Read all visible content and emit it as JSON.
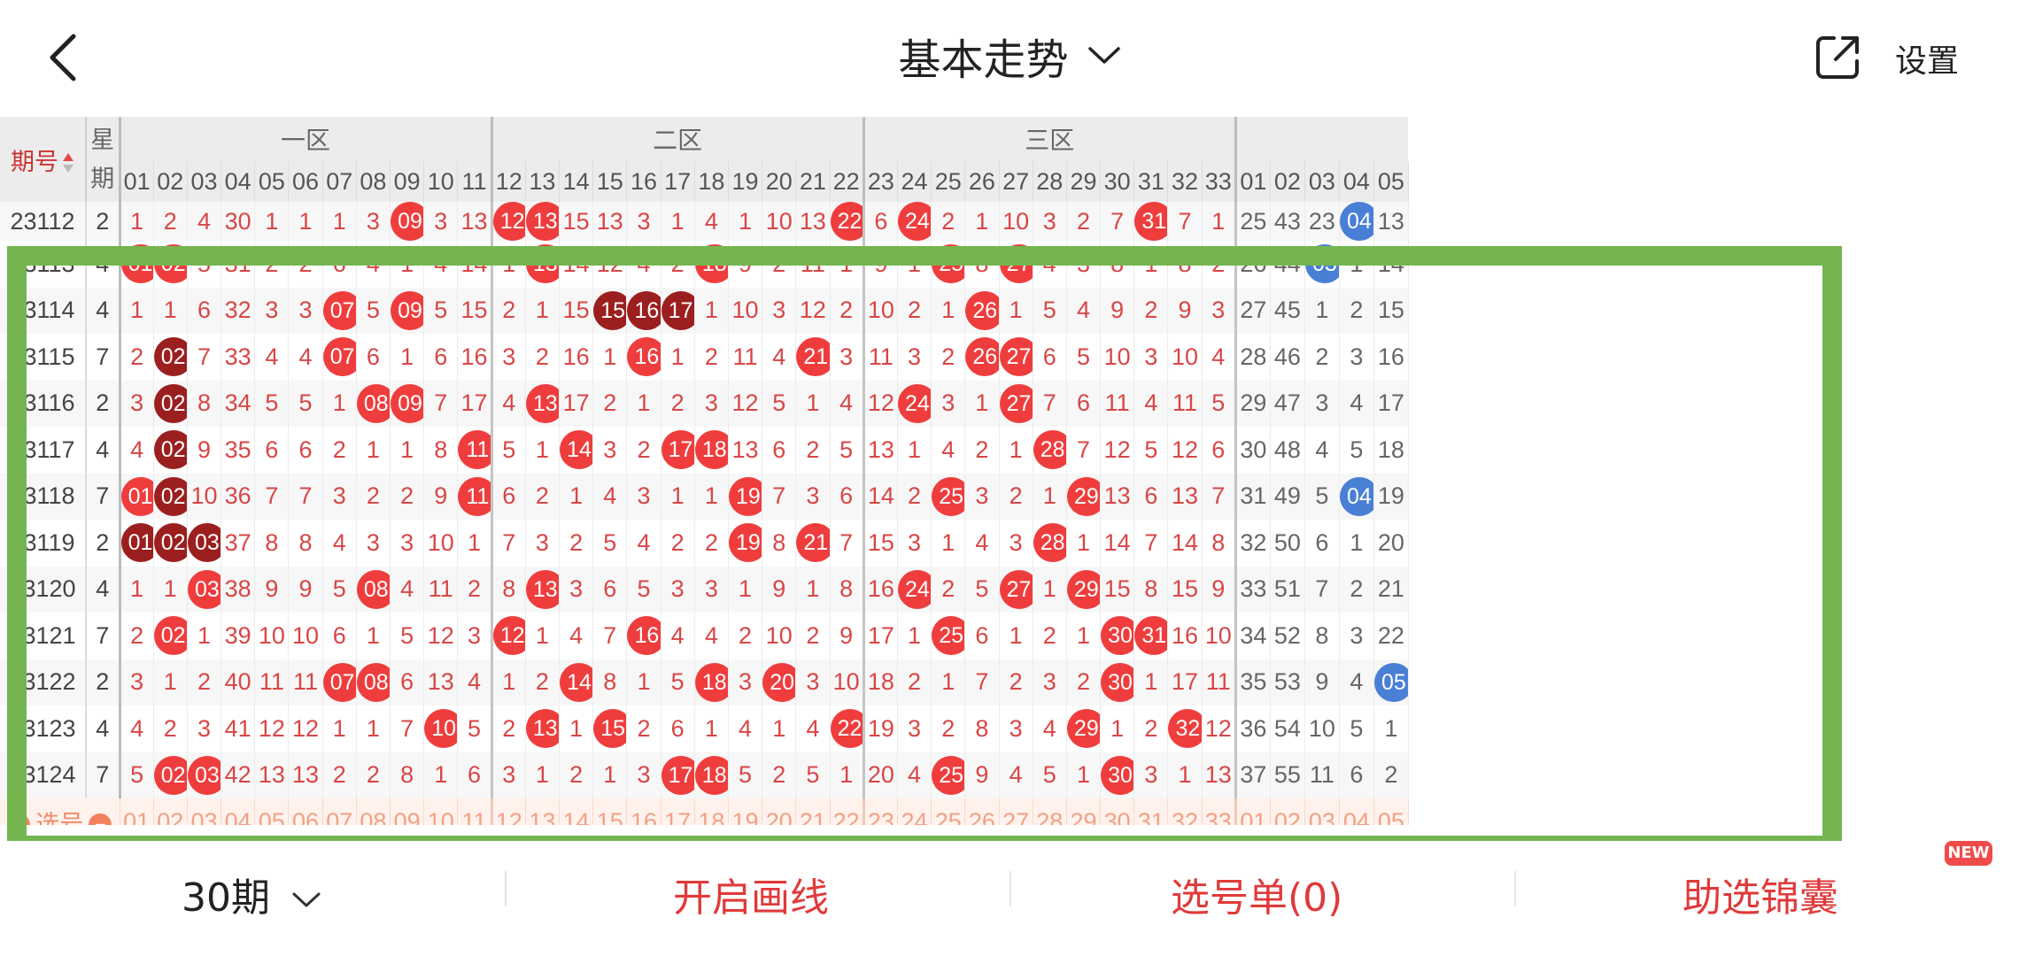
{
  "header": {
    "title": "基本走势",
    "settings_label": "设置"
  },
  "table": {
    "issue_header": "期号",
    "week_header": "星期",
    "zones": [
      "一区",
      "二区",
      "三区"
    ],
    "num_headers_left": [
      "01",
      "02",
      "03",
      "04",
      "05",
      "06",
      "07",
      "08",
      "09",
      "10",
      "11",
      "12",
      "13",
      "14",
      "15",
      "16",
      "17",
      "18",
      "19",
      "20",
      "21",
      "22",
      "23",
      "24",
      "25",
      "26",
      "27",
      "28",
      "29",
      "30",
      "31",
      "32",
      "33"
    ],
    "num_headers_right": [
      "01",
      "02",
      "03",
      "04",
      "05"
    ],
    "rows": [
      {
        "issue": "23112",
        "week": "2",
        "partial": true,
        "cells": [
          "1",
          "2",
          "4",
          "30",
          "1",
          "1",
          "1",
          "3",
          "09",
          "3",
          "13",
          "12",
          "13",
          "15",
          "13",
          "3",
          "1",
          "4",
          "1",
          "10",
          "13",
          "22",
          "6",
          "24",
          "2",
          "1",
          "10",
          "3",
          "2",
          "7",
          "31",
          "7",
          "1"
        ],
        "balls": {
          "9": "red",
          "12": "red",
          "13": "red",
          "22": "red",
          "24": "red",
          "31": "red"
        },
        "right": [
          "25",
          "43",
          "23",
          "04",
          "13"
        ],
        "rballs": {
          "4": "blue"
        }
      },
      {
        "issue": "23113",
        "week": "4",
        "cells": [
          "01",
          "02",
          "5",
          "31",
          "2",
          "2",
          "6",
          "4",
          "1",
          "4",
          "14",
          "1",
          "13",
          "14",
          "12",
          "4",
          "2",
          "18",
          "9",
          "2",
          "11",
          "1",
          "9",
          "1",
          "25",
          "8",
          "27",
          "4",
          "3",
          "8",
          "1",
          "8",
          "2"
        ],
        "balls": {
          "1": "red",
          "2": "red",
          "13": "red",
          "18": "red",
          "25": "red",
          "27": "red"
        },
        "right": [
          "26",
          "44",
          "03",
          "1",
          "14"
        ],
        "rballs": {
          "3": "blue"
        }
      },
      {
        "issue": "23114",
        "week": "4",
        "cells": [
          "1",
          "1",
          "6",
          "32",
          "3",
          "3",
          "07",
          "5",
          "09",
          "5",
          "15",
          "2",
          "1",
          "15",
          "15",
          "16",
          "17",
          "1",
          "10",
          "3",
          "12",
          "2",
          "10",
          "2",
          "1",
          "26",
          "1",
          "5",
          "4",
          "9",
          "2",
          "9",
          "3"
        ],
        "balls": {
          "7": "red",
          "9": "red",
          "15": "dark",
          "16": "dark",
          "17": "dark",
          "26": "red"
        },
        "right": [
          "27",
          "45",
          "1",
          "2",
          "15"
        ],
        "rballs": {}
      },
      {
        "issue": "23115",
        "week": "7",
        "cells": [
          "2",
          "02",
          "7",
          "33",
          "4",
          "4",
          "07",
          "6",
          "1",
          "6",
          "16",
          "3",
          "2",
          "16",
          "1",
          "16",
          "1",
          "2",
          "11",
          "4",
          "21",
          "3",
          "11",
          "3",
          "2",
          "26",
          "27",
          "6",
          "5",
          "10",
          "3",
          "10",
          "4"
        ],
        "balls": {
          "2": "dark",
          "7": "red",
          "16": "red",
          "21": "red",
          "26": "red",
          "27": "red"
        },
        "right": [
          "28",
          "46",
          "2",
          "3",
          "16"
        ],
        "rballs": {}
      },
      {
        "issue": "23116",
        "week": "2",
        "cells": [
          "3",
          "02",
          "8",
          "34",
          "5",
          "5",
          "1",
          "08",
          "09",
          "7",
          "17",
          "4",
          "13",
          "17",
          "2",
          "1",
          "2",
          "3",
          "12",
          "5",
          "1",
          "4",
          "12",
          "24",
          "3",
          "1",
          "27",
          "7",
          "6",
          "11",
          "4",
          "11",
          "5"
        ],
        "balls": {
          "2": "dark",
          "8": "red",
          "9": "red",
          "13": "red",
          "24": "red",
          "27": "red"
        },
        "right": [
          "29",
          "47",
          "3",
          "4",
          "17"
        ],
        "rballs": {}
      },
      {
        "issue": "23117",
        "week": "4",
        "cells": [
          "4",
          "02",
          "9",
          "35",
          "6",
          "6",
          "2",
          "1",
          "1",
          "8",
          "11",
          "5",
          "1",
          "14",
          "3",
          "2",
          "17",
          "18",
          "13",
          "6",
          "2",
          "5",
          "13",
          "1",
          "4",
          "2",
          "1",
          "28",
          "7",
          "12",
          "5",
          "12",
          "6"
        ],
        "balls": {
          "2": "dark",
          "11": "red",
          "14": "red",
          "17": "red",
          "18": "red",
          "28": "red"
        },
        "right": [
          "30",
          "48",
          "4",
          "5",
          "18"
        ],
        "rballs": {}
      },
      {
        "issue": "23118",
        "week": "7",
        "cells": [
          "01",
          "02",
          "10",
          "36",
          "7",
          "7",
          "3",
          "2",
          "2",
          "9",
          "11",
          "6",
          "2",
          "1",
          "4",
          "3",
          "1",
          "1",
          "19",
          "7",
          "3",
          "6",
          "14",
          "2",
          "25",
          "3",
          "2",
          "1",
          "29",
          "13",
          "6",
          "13",
          "7"
        ],
        "balls": {
          "1": "red",
          "2": "dark",
          "11": "red",
          "19": "red",
          "25": "red",
          "29": "red"
        },
        "right": [
          "31",
          "49",
          "5",
          "04",
          "19"
        ],
        "rballs": {
          "4": "blue"
        }
      },
      {
        "issue": "23119",
        "week": "2",
        "cells": [
          "01",
          "02",
          "03",
          "37",
          "8",
          "8",
          "4",
          "3",
          "3",
          "10",
          "1",
          "7",
          "3",
          "2",
          "5",
          "4",
          "2",
          "2",
          "19",
          "8",
          "21",
          "7",
          "15",
          "3",
          "1",
          "4",
          "3",
          "28",
          "1",
          "14",
          "7",
          "14",
          "8"
        ],
        "balls": {
          "1": "dark",
          "2": "dark",
          "3": "dark",
          "19": "red",
          "21": "red",
          "28": "red"
        },
        "right": [
          "32",
          "50",
          "6",
          "1",
          "20"
        ],
        "rballs": {}
      },
      {
        "issue": "23120",
        "week": "4",
        "cells": [
          "1",
          "1",
          "03",
          "38",
          "9",
          "9",
          "5",
          "08",
          "4",
          "11",
          "2",
          "8",
          "13",
          "3",
          "6",
          "5",
          "3",
          "3",
          "1",
          "9",
          "1",
          "8",
          "16",
          "24",
          "2",
          "5",
          "27",
          "1",
          "29",
          "15",
          "8",
          "15",
          "9"
        ],
        "balls": {
          "3": "red",
          "8": "red",
          "13": "red",
          "24": "red",
          "27": "red",
          "29": "red"
        },
        "right": [
          "33",
          "51",
          "7",
          "2",
          "21"
        ],
        "rballs": {}
      },
      {
        "issue": "23121",
        "week": "7",
        "cells": [
          "2",
          "02",
          "1",
          "39",
          "10",
          "10",
          "6",
          "1",
          "5",
          "12",
          "3",
          "12",
          "1",
          "4",
          "7",
          "16",
          "4",
          "4",
          "2",
          "10",
          "2",
          "9",
          "17",
          "1",
          "25",
          "6",
          "1",
          "2",
          "1",
          "30",
          "31",
          "16",
          "10"
        ],
        "balls": {
          "2": "red",
          "12": "red",
          "16": "red",
          "25": "red",
          "30": "red",
          "31": "red"
        },
        "right": [
          "34",
          "52",
          "8",
          "3",
          "22"
        ],
        "rballs": {}
      },
      {
        "issue": "23122",
        "week": "2",
        "cells": [
          "3",
          "1",
          "2",
          "40",
          "11",
          "11",
          "07",
          "08",
          "6",
          "13",
          "4",
          "1",
          "2",
          "14",
          "8",
          "1",
          "5",
          "18",
          "3",
          "20",
          "3",
          "10",
          "18",
          "2",
          "1",
          "7",
          "2",
          "3",
          "2",
          "30",
          "1",
          "17",
          "11"
        ],
        "balls": {
          "7": "red",
          "8": "red",
          "14": "red",
          "18": "red",
          "20": "red",
          "30": "red"
        },
        "right": [
          "35",
          "53",
          "9",
          "4",
          "05"
        ],
        "rballs": {
          "5": "blue"
        }
      },
      {
        "issue": "23123",
        "week": "4",
        "cells": [
          "4",
          "2",
          "3",
          "41",
          "12",
          "12",
          "1",
          "1",
          "7",
          "10",
          "5",
          "2",
          "13",
          "1",
          "15",
          "2",
          "6",
          "1",
          "4",
          "1",
          "4",
          "22",
          "19",
          "3",
          "2",
          "8",
          "3",
          "4",
          "29",
          "1",
          "2",
          "32",
          "12"
        ],
        "balls": {
          "10": "red",
          "13": "red",
          "15": "red",
          "22": "red",
          "29": "red",
          "32": "red"
        },
        "right": [
          "36",
          "54",
          "10",
          "5",
          "1"
        ],
        "rballs": {}
      },
      {
        "issue": "23124",
        "week": "7",
        "cells": [
          "5",
          "02",
          "03",
          "42",
          "13",
          "13",
          "2",
          "2",
          "8",
          "1",
          "6",
          "3",
          "1",
          "2",
          "1",
          "3",
          "17",
          "18",
          "5",
          "2",
          "5",
          "1",
          "20",
          "4",
          "25",
          "9",
          "4",
          "5",
          "1",
          "30",
          "3",
          "1",
          "13"
        ],
        "balls": {
          "2": "red",
          "3": "red",
          "17": "red",
          "18": "red",
          "25": "red",
          "30": "red"
        },
        "right": [
          "37",
          "55",
          "11",
          "6",
          "2"
        ],
        "rballs": {}
      }
    ],
    "pick_label": "选号"
  },
  "footer": {
    "period_label": "30期",
    "draw_lines_label": "开启画线",
    "pick_list_label": "选号单(0)",
    "tips_label": "助选锦囊",
    "new_badge": "NEW"
  }
}
